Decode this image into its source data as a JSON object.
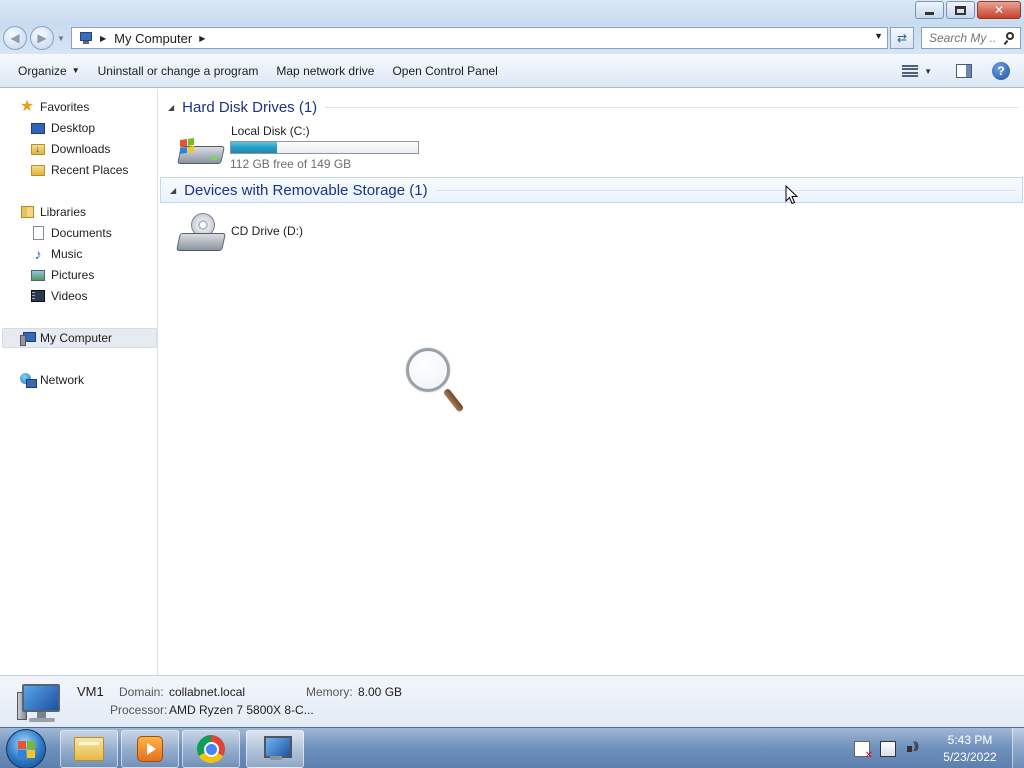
{
  "window": {
    "minimize_icon": "minimize-icon",
    "maximize_icon": "restore-icon",
    "close_icon": "close-icon"
  },
  "address": {
    "path": "My Computer",
    "search_placeholder": "Search My ..."
  },
  "toolbar": {
    "organize": "Organize",
    "uninstall": "Uninstall or change a program",
    "map_drive": "Map network drive",
    "control_panel": "Open Control Panel",
    "help_glyph": "?"
  },
  "sidebar": {
    "favorites": "Favorites",
    "desktop": "Desktop",
    "downloads": "Downloads",
    "recent_places": "Recent Places",
    "libraries": "Libraries",
    "documents": "Documents",
    "music": "Music",
    "pictures": "Pictures",
    "videos": "Videos",
    "my_computer": "My Computer",
    "network": "Network"
  },
  "groups": {
    "hard_disks": "Hard Disk Drives (1)",
    "removable": "Devices with Removable Storage (1)"
  },
  "drives": {
    "c": {
      "name": "Local Disk (C:)",
      "free_text": "112 GB free of 149 GB",
      "used_fraction": 0.248
    },
    "d": {
      "name": "CD Drive (D:)"
    }
  },
  "details": {
    "computer_name": "VM1",
    "domain_label": "Domain:",
    "domain_value": "collabnet.local",
    "memory_label": "Memory:",
    "memory_value": "8.00 GB",
    "processor_label": "Processor:",
    "processor_value": "AMD Ryzen 7 5800X 8-C..."
  },
  "taskbar": {
    "time": "5:43 PM",
    "date": "5/23/2022"
  },
  "colors": {
    "capacity_fill": "#26a0c8",
    "group_title": "#1e3287",
    "taskbar": "#6f90bb"
  }
}
